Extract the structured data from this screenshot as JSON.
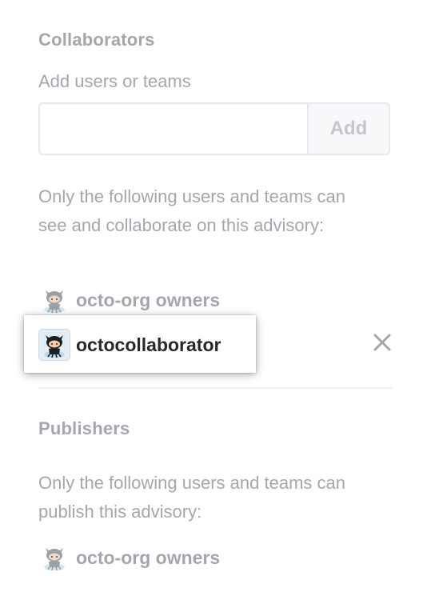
{
  "collaborators": {
    "title": "Collaborators",
    "add_label": "Add users or teams",
    "input": {
      "value": "",
      "placeholder": ""
    },
    "add_button_label": "Add",
    "description": "Only the following users and teams can see and collaborate on this advisory:",
    "members": [
      {
        "name": "octo-org owners",
        "avatar": "octocat-avatar-icon"
      },
      {
        "name": "octocollaborator",
        "avatar": "octocat-avatar-icon",
        "highlighted": true,
        "removable": true
      }
    ],
    "remove_icon": "close-icon"
  },
  "publishers": {
    "title": "Publishers",
    "description": "Only the following users and teams can publish this advisory:",
    "members": [
      {
        "name": "octo-org owners",
        "avatar": "octocat-avatar-icon"
      }
    ]
  },
  "colors": {
    "muted_text": "#a3a7ad",
    "strong_text": "#24292e",
    "border": "#e6e8eb",
    "button_bg": "#f7f8fa",
    "button_text": "#c3c7cc",
    "divider": "#eceef0"
  }
}
